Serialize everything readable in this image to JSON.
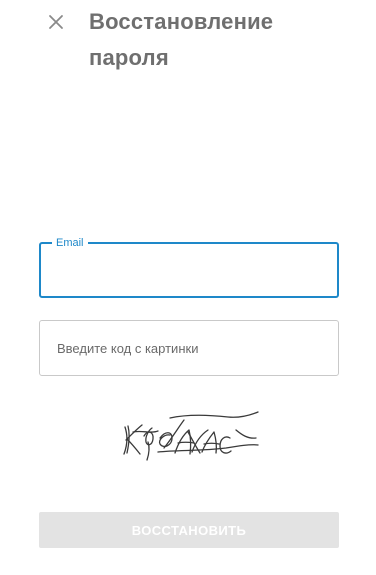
{
  "header": {
    "close_icon": "close-icon",
    "title": "Восстановление пароля"
  },
  "email_field": {
    "label": "Email",
    "value": "",
    "state": "focused",
    "accent_color": "#1e88c9"
  },
  "code_field": {
    "placeholder": "Введите код с картинки",
    "value": ""
  },
  "captcha": {
    "icon": "captcha-image"
  },
  "submit_button": {
    "label": "ВОССТАНОВИТЬ",
    "state": "disabled"
  }
}
